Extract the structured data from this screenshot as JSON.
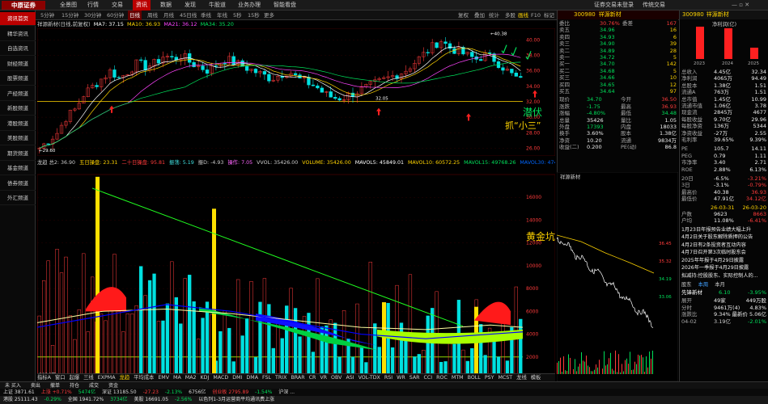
{
  "app": {
    "logo": "中原证券",
    "top_nav": [
      "全景图",
      "行情",
      "交易",
      "资讯",
      "数据",
      "发现",
      "牛股道",
      "业务办理",
      "智能看盘"
    ],
    "top_right": [
      "证券交易未登录",
      "传统交易"
    ]
  },
  "toolbar": {
    "items": [
      "分时",
      "1分钟",
      "5分钟",
      "15分钟",
      "30分钟",
      "60分钟",
      "日线",
      "周线",
      "月线",
      "45日线",
      "季线",
      "年线",
      "5秒",
      "15秒",
      "更多"
    ],
    "active": "日线",
    "right": [
      "复权",
      "叠加",
      "统计",
      "多股",
      "画线",
      "F10",
      "标记"
    ]
  },
  "sidebar": {
    "items": [
      "资讯首页",
      "精华资讯",
      "自选资讯",
      "财经频道",
      "股票频道",
      "产经频道",
      "新股频道",
      "港股频道",
      "美股频道",
      "期货频道",
      "基金频道",
      "债券频道",
      "外汇频道"
    ],
    "active": "资讯首页"
  },
  "chart": {
    "title": "祥源新材(日线,前复权)",
    "ma_label": "MA7: 37.15",
    "ma10": "MA10: 36.93",
    "ma21": "MA21: 36.12",
    "ma34": "MA34: 35.20",
    "price_high": "40.38",
    "price_mark1": "32.05",
    "price_low": "29.60",
    "y_ticks": [
      "40.00",
      "38.00",
      "36.00",
      "34.00",
      "32.00",
      "30.00",
      "28.00",
      "26.00"
    ],
    "support_label": "32.05"
  },
  "annotations": {
    "qianfu": "潜伏",
    "zhuaxiaosan": "抓“小三”",
    "huangjinkeng": "黄金坑"
  },
  "indicator": {
    "items": [
      {
        "t": "龙趋 总2: 36.90",
        "c": "#ccc"
      },
      {
        "t": "五日操盘: 23.31",
        "c": "#ffd400"
      },
      {
        "t": "二十日操盘: 95.81",
        "c": "#ff3b3b"
      },
      {
        "t": "振荡: 5.19",
        "c": "#40e0e0"
      },
      {
        "t": "振D: -4.93",
        "c": "#ccc"
      },
      {
        "t": "操作: 7.05",
        "c": "#ff66ff"
      },
      {
        "t": "VVOL: 35426.00",
        "c": "#ccc"
      },
      {
        "t": "VOLUME: 35426.00",
        "c": "#ffd400"
      },
      {
        "t": "MAVOL5: 45849.01",
        "c": "#fff"
      },
      {
        "t": "MAVOL10: 60572.25",
        "c": "#ffd400"
      },
      {
        "t": "MAVOL15: 49768.26",
        "c": "#00e05a"
      },
      {
        "t": "MAVOL30: 47434.30",
        "c": "#0066ff"
      }
    ],
    "y_ticks": [
      "16000",
      "14000",
      "12000",
      "10000",
      "8000",
      "6000",
      "4000",
      "2000"
    ],
    "x_label": "2026年",
    "mid_label": "3"
  },
  "ind_tabs": [
    "指标A",
    "窗口",
    "起爆",
    "三线",
    "EXPMA",
    "龙趋",
    "平均成本",
    "EMV",
    "MA",
    "MA2",
    "KDJ",
    "MACD",
    "DMI",
    "DMA",
    "FSL",
    "TRIX",
    "BRAR",
    "CR",
    "VR",
    "OBV",
    "ASI",
    "VOL-TDX",
    "RSI",
    "WR",
    "SAR",
    "CCI",
    "ROC",
    "MTM",
    "BOLL",
    "PSY",
    "MCST",
    "龙线",
    "模板"
  ],
  "quote": {
    "stock_code": "300980",
    "stock_name": "祥源新材",
    "weibi_label": "委比",
    "weibi": "30.76%",
    "weicha_label": "委差",
    "weicha": "167",
    "asks": [
      {
        "l": "卖五",
        "p": "34.96",
        "v": "16"
      },
      {
        "l": "卖四",
        "p": "34.93",
        "v": "6"
      },
      {
        "l": "卖三",
        "p": "34.90",
        "v": "39"
      },
      {
        "l": "卖二",
        "p": "34.89",
        "v": "28"
      },
      {
        "l": "卖一",
        "p": "34.72",
        "v": "5"
      }
    ],
    "bids": [
      {
        "l": "买一",
        "p": "34.70",
        "v": "142"
      },
      {
        "l": "买二",
        "p": "34.68",
        "v": "5"
      },
      {
        "l": "买三",
        "p": "34.66",
        "v": "10"
      },
      {
        "l": "买四",
        "p": "34.65",
        "v": "12"
      },
      {
        "l": "买五",
        "p": "34.64",
        "v": "97"
      }
    ],
    "stats": [
      [
        "现价",
        "34.70",
        "今开",
        "36.50"
      ],
      [
        "涨跌",
        "-1.75",
        "最高",
        "36.93"
      ],
      [
        "涨幅",
        "-4.80%",
        "最低",
        "34.48"
      ],
      [
        "总量",
        "35426",
        "量比",
        "1.05"
      ],
      [
        "外盘",
        "17393",
        "内盘",
        "18033"
      ],
      [
        "换手",
        "3.60%",
        "股本",
        "1.38亿"
      ],
      [
        "净资",
        "10.20",
        "流通",
        "9834万"
      ],
      [
        "收益(二)",
        "0.200",
        "PE(动)",
        "86.8"
      ]
    ]
  },
  "right_panel": {
    "code": "300980",
    "name": "祥源新材",
    "sub": "净利润(亿)",
    "bars_years": [
      "2023",
      "2024",
      "2025"
    ],
    "values": [
      "4.00",
      "3.50",
      "1.0"
    ],
    "rows": [
      [
        "总收入",
        "4.45亿",
        "32.34"
      ],
      [
        "净利润",
        "4065万",
        "94.49"
      ],
      [
        "总股本",
        "1.38亿",
        "1.51"
      ],
      [
        "流通A",
        "763万",
        "1.51"
      ],
      [
        "总市值",
        "1.45亿",
        "10.99"
      ],
      [
        "流通市值",
        "1.06亿",
        "3.78"
      ],
      [
        "现金流",
        "2845万",
        "4677"
      ],
      [
        "每股收益",
        "9.70亿",
        "29.96"
      ],
      [
        "每股净资",
        "136万",
        "5344"
      ],
      [
        "净资收益",
        "-27万",
        "2.55"
      ],
      [
        "毛利率",
        "39.65%",
        "9.39%"
      ]
    ],
    "pe_rows": [
      [
        "PE",
        "105.7",
        "14.11"
      ],
      [
        "PEG",
        "0.79",
        "1.11"
      ],
      [
        "市净率",
        "3.40",
        "2.71"
      ],
      [
        "ROE",
        "2.88%",
        "6.13%"
      ]
    ],
    "change_rows": [
      [
        "20日",
        "-6.5%",
        "-3.21%"
      ],
      [
        "3日",
        "-3.1%",
        "-0.79%"
      ],
      [
        "最高价",
        "40.38",
        "36.93"
      ],
      [
        "最低价",
        "47.91亿",
        "34.12亿"
      ]
    ],
    "date_row": [
      "26-03-31",
      "26-03-20"
    ],
    "holder_rows": [
      [
        "户数",
        "9623",
        "8663"
      ],
      [
        "户均",
        "11.08%",
        "-6.41%"
      ]
    ],
    "news": [
      "1月23日年报预告业绩大幅上升",
      "4月2日关于股东解除质押的公告",
      "4月2日有2条投资者互动内容",
      "4月7日召开第3次临时股东会",
      "2025年年报于4月29日披露",
      "2026年一季报于4月29日披露",
      "拟减持:控股股东、实际控制人的..."
    ],
    "fund_tabs": [
      "股东",
      "本周",
      "本月"
    ],
    "fund_label": "先锋新材",
    "fund_val": "6.10",
    "fund_chg": "-3.95%",
    "fund_items": [
      [
        "展开",
        "49家",
        "449万股"
      ],
      [
        "分时",
        "9461万(4)",
        "4.83%"
      ],
      [
        "涨跌比",
        "9.34%",
        "最新价 5.06亿"
      ]
    ],
    "fund_date": "04-02",
    "fund_amount": "3.19亿",
    "fund_pct": "-2.01%"
  },
  "bottom": {
    "row1": [
      "未 买入",
      "卖出",
      "撤单",
      "持仓",
      "成交",
      "资金"
    ],
    "row2": [
      "上证 3871.61",
      "上涨 +0.71%",
      "5474亿",
      "深证 13185.50",
      "-27.23",
      "-2.13%",
      "6756亿",
      "创业板 2795.89",
      "-1.54%",
      "沪深 ..."
    ],
    "row3": [
      "港股 25111.43",
      "-0.29%",
      "全国 1941.72%",
      "3734亿",
      "美股 16691.05",
      "-2.56%",
      "以色列1-3月运营商平均通讯费上涨"
    ]
  },
  "mini_chart": {
    "title": "祥源新材",
    "y_ticks": [
      "36.45",
      "35.32",
      "34.19",
      "33.06"
    ]
  },
  "colors": {
    "up": "#ff3b3b",
    "down": "#00e0e0",
    "ma5": "#ffffff",
    "ma10": "#ffd400",
    "ma21": "#ff44ff",
    "ma34": "#00e05a",
    "accent": "#b00000"
  }
}
